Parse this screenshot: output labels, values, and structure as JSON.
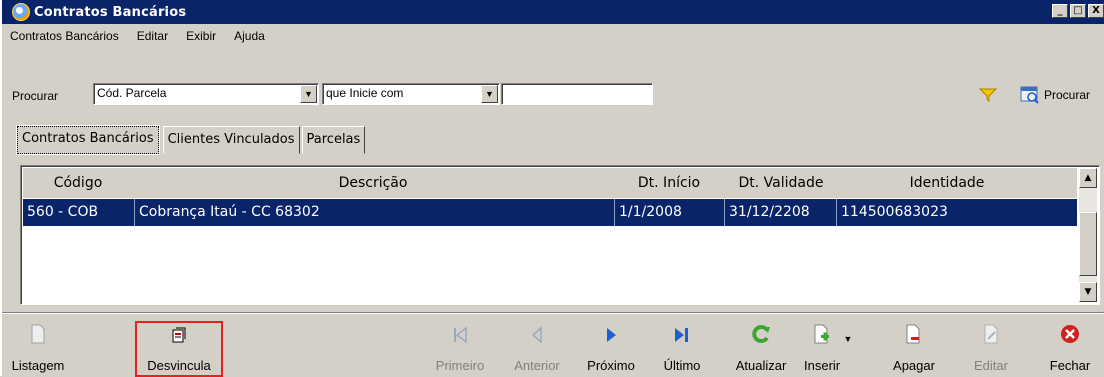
{
  "window": {
    "title": "Contratos Bancários",
    "controls": [
      "_",
      "□",
      "X"
    ]
  },
  "menu": [
    "Contratos Bancários",
    "Editar",
    "Exibir",
    "Ajuda"
  ],
  "search": {
    "label": "Procurar",
    "field_value": "Cód. Parcela",
    "operator_value": "que Inicie com",
    "text_value": "",
    "button_label": "Procurar"
  },
  "tabs": [
    "Contratos Bancários",
    "Clientes Vinculados",
    "Parcelas"
  ],
  "grid": {
    "columns": [
      "Código",
      "Descrição",
      "Dt. Início",
      "Dt. Validade",
      "Identidade"
    ],
    "rows": [
      {
        "codigo": "560 - COB",
        "descricao": "Cobrança Itaú - CC 68302",
        "dt_inicio": "1/1/2008",
        "dt_validade": "31/12/2208",
        "identidade": "114500683023"
      }
    ]
  },
  "toolbar": {
    "listagem": "Listagem",
    "desvincula": "Desvincula",
    "primeiro": "Primeiro",
    "anterior": "Anterior",
    "proximo": "Próximo",
    "ultimo": "Último",
    "atualizar": "Atualizar",
    "inserir": "Inserir",
    "apagar": "Apagar",
    "editar": "Editar",
    "fechar": "Fechar"
  },
  "colors": {
    "titlebar": "#0a246a",
    "selection": "#0a246a",
    "highlight_box": "#e82020",
    "nav_blue": "#1e5fd0",
    "refresh_green": "#3aa830",
    "close_red": "#d02020"
  }
}
